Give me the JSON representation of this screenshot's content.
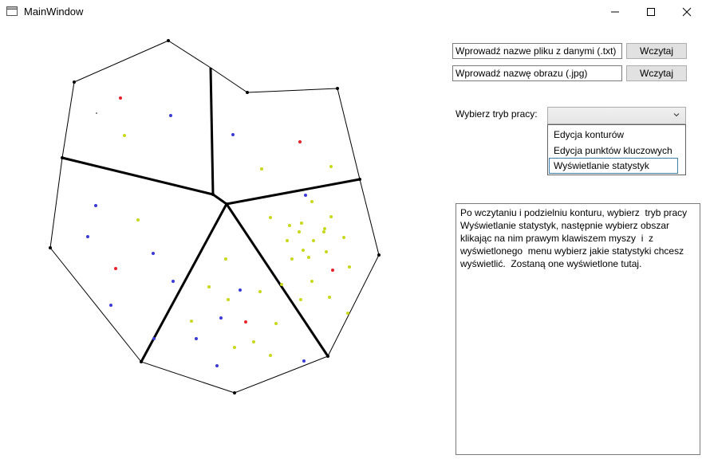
{
  "window": {
    "title": "MainWindow"
  },
  "controls": {
    "data_file_input": {
      "value": "Wprowadź nazwe pliku z danymi (.txt)"
    },
    "data_file_button": "Wczytaj",
    "image_file_input": {
      "value": "Wprowadź nazwę obrazu (.jpg)"
    },
    "image_file_button": "Wczytaj",
    "mode_label": "Wybierz tryb pracy:",
    "mode_select": {
      "value": "",
      "options": [
        "Edycja konturów",
        "Edycja punktów kluczowych",
        "Wyświetlanie statystyk"
      ],
      "highlighted": "Wyświetlanie statystyk"
    },
    "info_text": "Po wczytaniu i podzielniu konturu, wybierz  tryb pracy\nWyświetlanie statystyk, następnie wybierz obszar\nklikając na nim prawym klawiszem myszy  i  z\nwyświetlonego  menu wybierz jakie statystyki chcesz\nwyświetlić.  Zostaną one wyświetlone tutaj."
  },
  "colors": {
    "outline": "#000000",
    "point_red": "#e8202a",
    "point_blue": "#3a3ad6",
    "point_yellow": "#c8d81a",
    "selected_border": "#3c7fb1"
  }
}
